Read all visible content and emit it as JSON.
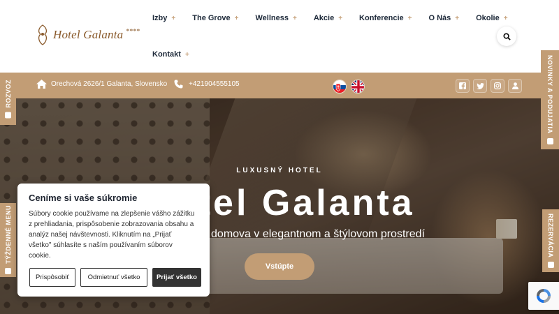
{
  "logo": {
    "text": "Hotel Galanta",
    "stars": "****"
  },
  "nav": {
    "row1": [
      "Izby",
      "The Grove",
      "Wellness",
      "Akcie",
      "Konferencie",
      "O Nás",
      "Okolie"
    ],
    "row2": [
      "Kontakt"
    ],
    "plus": "+"
  },
  "infobar": {
    "address": "Orechová 2626/1 Galanta, Slovensko",
    "phone": "+421904555105",
    "social_icons": [
      "facebook-icon",
      "twitter-icon",
      "instagram-icon",
      "user-icon"
    ]
  },
  "hero": {
    "subtitle": "LUXUSNÝ HOTEL",
    "title": "Hotel Galanta",
    "tagline": "domova v elegantnom a štýlovom prostredí",
    "button": "Vstúpte"
  },
  "side_tabs": {
    "rozvoz": "ROZVOZ",
    "tyzdenne_menu": "TÝŽDENNÉ MENU",
    "novinky": "NOVINKY A PODUJATIA",
    "rezervacia": "REZERVÁCIA"
  },
  "cookie": {
    "title": "Ceníme si vaše súkromie",
    "text": "Súbory cookie používame na zlepšenie vášho zážitku z prehliadania, prispôsobenie zobrazovania obsahu a analýz našej návštevnosti. Kliknutím na „Prijať všetko\" súhlasíte s naším používaním súborov cookie.",
    "btn_customize": "Prispôsobiť",
    "btn_reject": "Odmietnuť všetko",
    "btn_accept": "Prijať všetko"
  },
  "colors": {
    "accent": "#c29d75",
    "nav_text": "#1e2a3a",
    "plus": "#c8a47e"
  }
}
